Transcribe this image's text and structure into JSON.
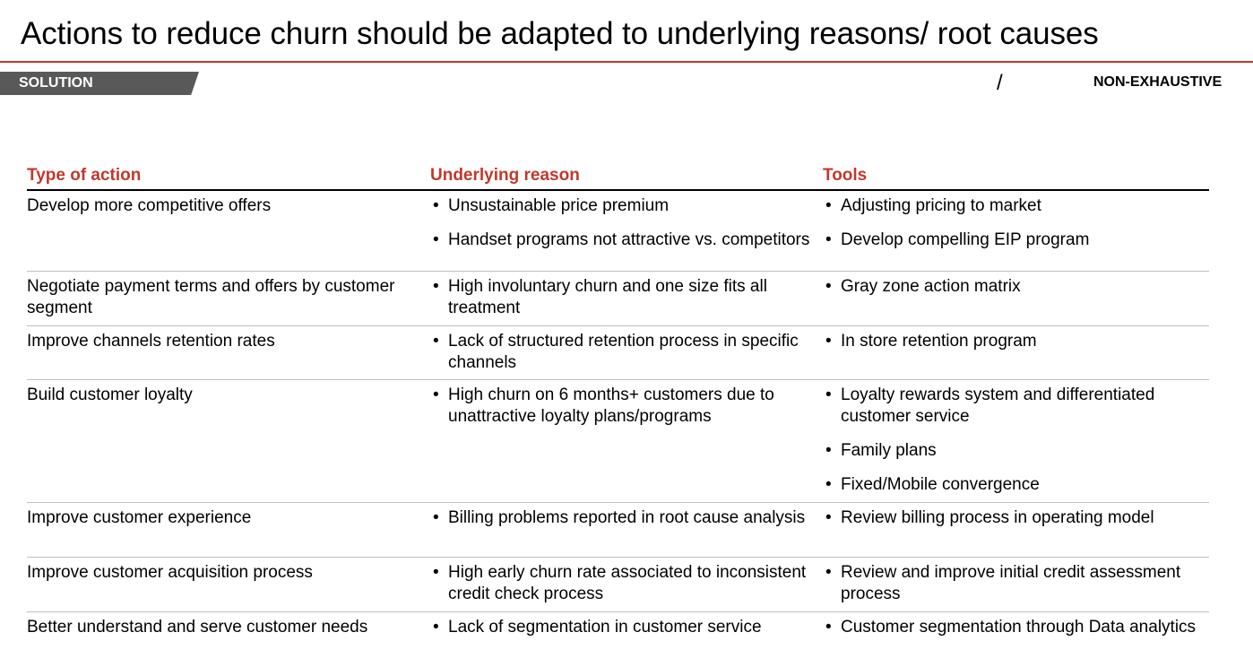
{
  "slide": {
    "title": "Actions to reduce churn should be adapted to underlying reasons/ root causes",
    "tag": "SOLUTION",
    "tracker": "NON-EXHAUSTIVE",
    "divider_glyph": "/"
  },
  "colors": {
    "accent": "#c0392b",
    "tag_background": "#595959",
    "row_divider": "#bfbfbf"
  },
  "table": {
    "headers": [
      "Type of action",
      "Underlying reason",
      "Tools"
    ],
    "rows": [
      {
        "action": "Develop more competitive offers",
        "reasons": [
          "Unsustainable price premium",
          "Handset programs not attractive vs. competitors"
        ],
        "tools": [
          "Adjusting pricing to market",
          "Develop compelling EIP program"
        ]
      },
      {
        "action": "Negotiate payment terms and offers by customer segment",
        "reasons": [
          "High involuntary churn and one size fits all treatment"
        ],
        "tools": [
          "Gray zone action matrix"
        ]
      },
      {
        "action": "Improve channels retention rates",
        "reasons": [
          "Lack of structured retention process in specific channels"
        ],
        "tools": [
          "In store retention program"
        ]
      },
      {
        "action": "Build customer loyalty",
        "reasons": [
          "High churn on 6 months+ customers due to unattractive loyalty plans/programs"
        ],
        "tools": [
          "Loyalty rewards system and differentiated customer service",
          "Family plans",
          "Fixed/Mobile convergence"
        ]
      },
      {
        "action": "Improve customer experience",
        "reasons": [
          "Billing problems reported in root cause analysis"
        ],
        "tools": [
          "Review billing process in operating model"
        ]
      },
      {
        "action": "Improve customer acquisition process",
        "reasons": [
          "High early churn rate associated to inconsistent credit check process"
        ],
        "tools": [
          "Review and improve initial credit assessment process"
        ]
      },
      {
        "action": "Better understand and serve customer needs",
        "reasons": [
          "Lack of segmentation in customer service"
        ],
        "tools": [
          "Customer segmentation through Data analytics"
        ]
      }
    ]
  }
}
